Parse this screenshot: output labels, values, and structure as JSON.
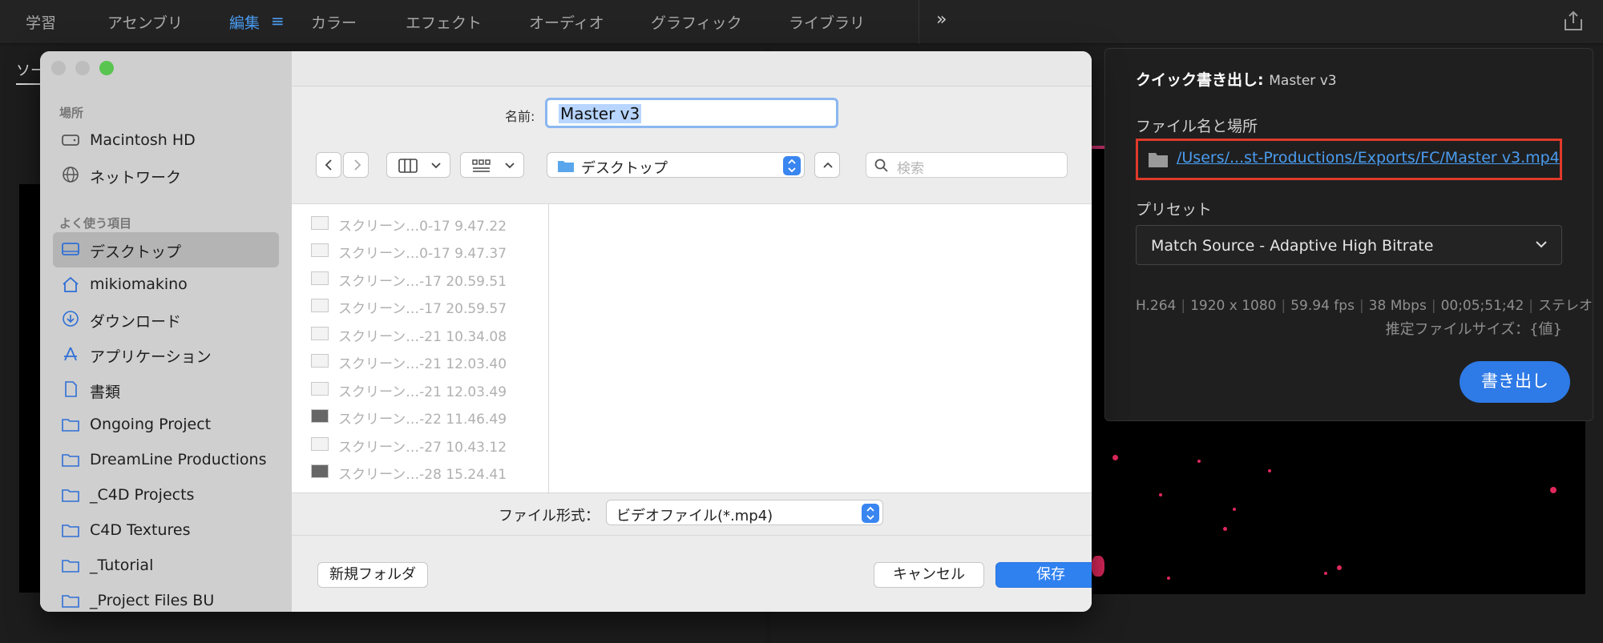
{
  "workspace": {
    "tabs": [
      "学習",
      "アセンブリ",
      "編集",
      "カラー",
      "エフェクト",
      "オーディオ",
      "グラフィック",
      "ライブラリ"
    ],
    "active_tab": "編集",
    "menu_icon": "hamburger-icon",
    "more_icon": "double-chevron-right-icon",
    "share_icon": "share-icon"
  },
  "source_panel": {
    "tab_label": "ソー"
  },
  "quick_export": {
    "title": "クイック書き出し:",
    "title_value": "Master v3",
    "file_label": "ファイル名と場所",
    "path": "/Users/...st-Productions/Exports/FC/Master v3.mp4",
    "preset_label": "プリセット",
    "preset_value": "Match Source - Adaptive High Bitrate",
    "info": [
      "H.264",
      "1920 x 1080",
      "59.94 fps",
      "38 Mbps",
      "00;05;51;42",
      "ステレオ"
    ],
    "size_label": "推定ファイルサイズ：{値}",
    "export_button": "書き出し",
    "highlight_color": "#e03a2a"
  },
  "save_dialog": {
    "name_label": "名前:",
    "name_value": "Master v3",
    "location": "デスクトップ",
    "search_placeholder": "検索",
    "sidebar": {
      "places_header": "場所",
      "places": [
        {
          "label": "Macintosh HD",
          "icon": "hard-drive-icon"
        },
        {
          "label": "ネットワーク",
          "icon": "globe-icon"
        }
      ],
      "favorites_header": "よく使う項目",
      "favorites": [
        {
          "label": "デスクトップ",
          "icon": "desktop-icon",
          "selected": true
        },
        {
          "label": "mikiomakino",
          "icon": "home-icon"
        },
        {
          "label": "ダウンロード",
          "icon": "download-icon"
        },
        {
          "label": "アプリケーション",
          "icon": "applications-icon"
        },
        {
          "label": "書類",
          "icon": "document-icon"
        },
        {
          "label": "Ongoing Project",
          "icon": "folder-icon"
        },
        {
          "label": "DreamLine Productions",
          "icon": "folder-icon"
        },
        {
          "label": "_C4D Projects",
          "icon": "folder-icon"
        },
        {
          "label": "C4D Textures",
          "icon": "folder-icon"
        },
        {
          "label": "_Tutorial",
          "icon": "folder-icon"
        },
        {
          "label": "_Project Files BU",
          "icon": "folder-icon"
        }
      ]
    },
    "files": [
      "スクリーン…0-17 9.47.22",
      "スクリーン…0-17 9.47.37",
      "スクリーン…-17 20.59.51",
      "スクリーン…-17 20.59.57",
      "スクリーン…-21 10.34.08",
      "スクリーン…-21 12.03.40",
      "スクリーン…-21 12.03.49",
      "スクリーン…-22 11.46.49",
      "スクリーン…-27 10.43.12",
      "スクリーン…-28 15.24.41"
    ],
    "format_label": "ファイル形式：",
    "format_value": "ビデオファイル(*.mp4)",
    "new_folder": "新規フォルダ",
    "cancel": "キャンセル",
    "save": "保存",
    "accent_color": "#2f81f0"
  }
}
